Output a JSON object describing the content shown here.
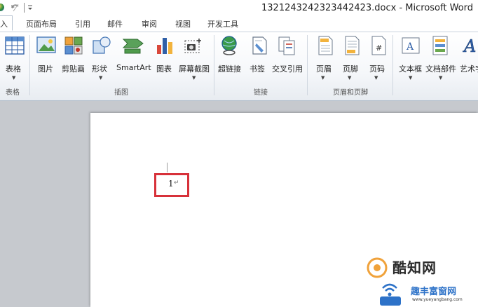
{
  "window": {
    "title": "1321243242323442423.docx - Microsoft Word"
  },
  "tabs": [
    {
      "label": "入",
      "active": true
    },
    {
      "label": "页面布局"
    },
    {
      "label": "引用"
    },
    {
      "label": "邮件"
    },
    {
      "label": "审阅"
    },
    {
      "label": "视图"
    },
    {
      "label": "开发工具"
    }
  ],
  "ribbon": {
    "groups": {
      "tables": "表格",
      "illustrations": "插图",
      "links": "链接",
      "header_footer": "页眉和页脚"
    },
    "buttons": {
      "table": "表格",
      "picture": "图片",
      "clipart": "剪贴画",
      "shapes": "形状",
      "smartart": "SmartArt",
      "chart": "图表",
      "screenshot": "屏幕截图",
      "hyperlink": "超链接",
      "bookmark": "书签",
      "crossref": "交叉引用",
      "header": "页眉",
      "footer": "页脚",
      "pagenumber": "页码",
      "textbox": "文本框",
      "quickparts": "文档部件",
      "wordart": "艺术字"
    },
    "dropdown_glyph": "▼"
  },
  "document": {
    "page_number": "1",
    "paragraph_mark": "↵"
  },
  "watermark": {
    "line1": "酷知网",
    "line2": "趣丰富窗网",
    "line3": "www.yueyangbang.com"
  },
  "colors": {
    "highlight": "#d7313a",
    "accent": "#2d72c8"
  }
}
